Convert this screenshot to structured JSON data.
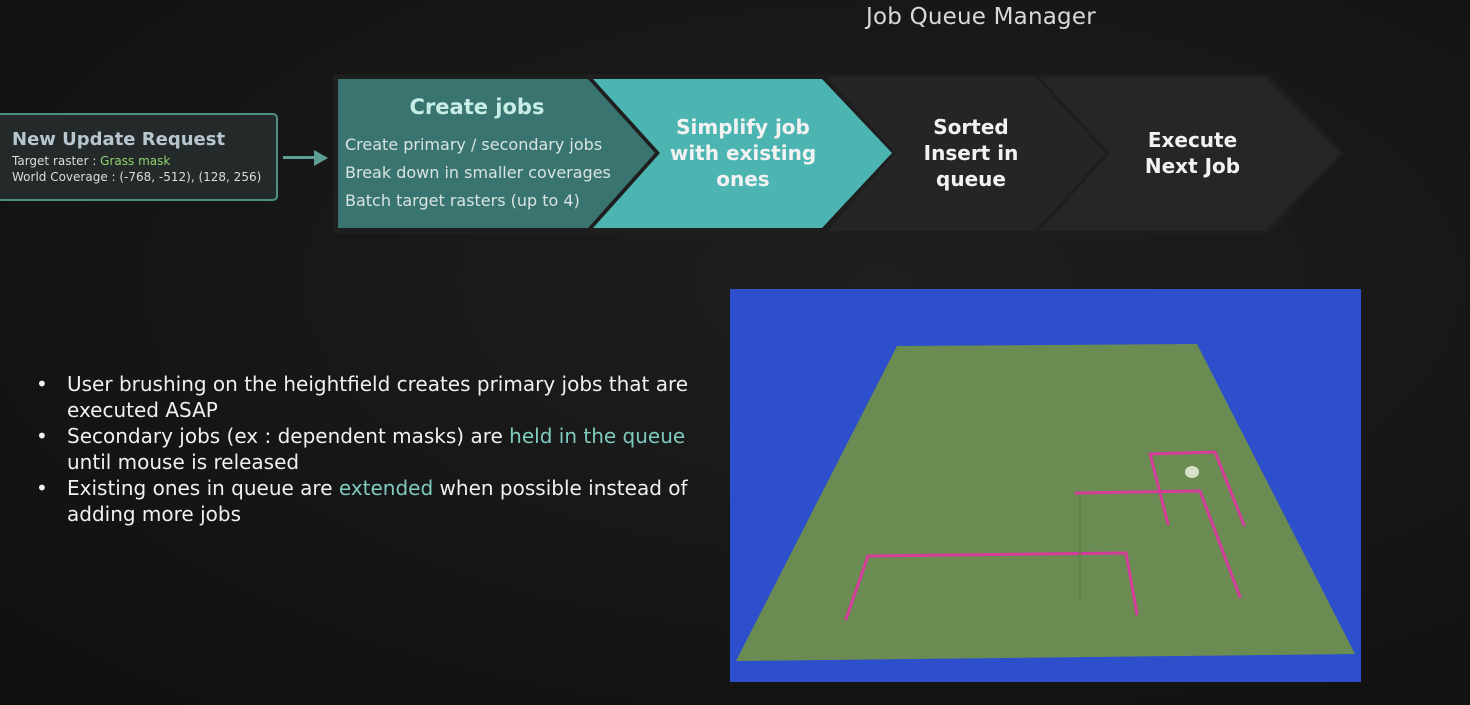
{
  "title": "Job Queue Manager",
  "request": {
    "title": "New Update Request",
    "target_label": "Target raster : ",
    "target_value": "Grass mask",
    "coverage_label": "World Coverage : ",
    "coverage_value": "(-768, -512), (128, 256)"
  },
  "pipeline": {
    "create": {
      "title": "Create jobs",
      "items": [
        "Create primary / secondary jobs",
        "Break down in smaller coverages",
        "Batch target rasters (up to 4)"
      ]
    },
    "simplify": [
      "Simplify job",
      "with existing",
      "ones"
    ],
    "sorted": [
      "Sorted",
      "Insert in",
      "queue"
    ],
    "execute": [
      "Execute",
      "Next Job"
    ]
  },
  "bullets": [
    {
      "before": "User brushing on the heightfield creates primary jobs that are executed ASAP",
      "highlight": "",
      "after": ""
    },
    {
      "before": "Secondary jobs (ex : dependent masks) are ",
      "highlight": "held in the queue",
      "after": " until mouse is released"
    },
    {
      "before": "Existing ones in queue are ",
      "highlight": "extended",
      "after": " when possible instead of adding more jobs"
    }
  ],
  "colors": {
    "teal_dark": "#3a7470",
    "teal_light": "#4db5b1",
    "step_dark": "#262626",
    "highlight": "#7fcbc0",
    "viewport_bg": "#2e4fcc",
    "terrain": "#6a8c52",
    "brush_line": "#d43c9a"
  }
}
